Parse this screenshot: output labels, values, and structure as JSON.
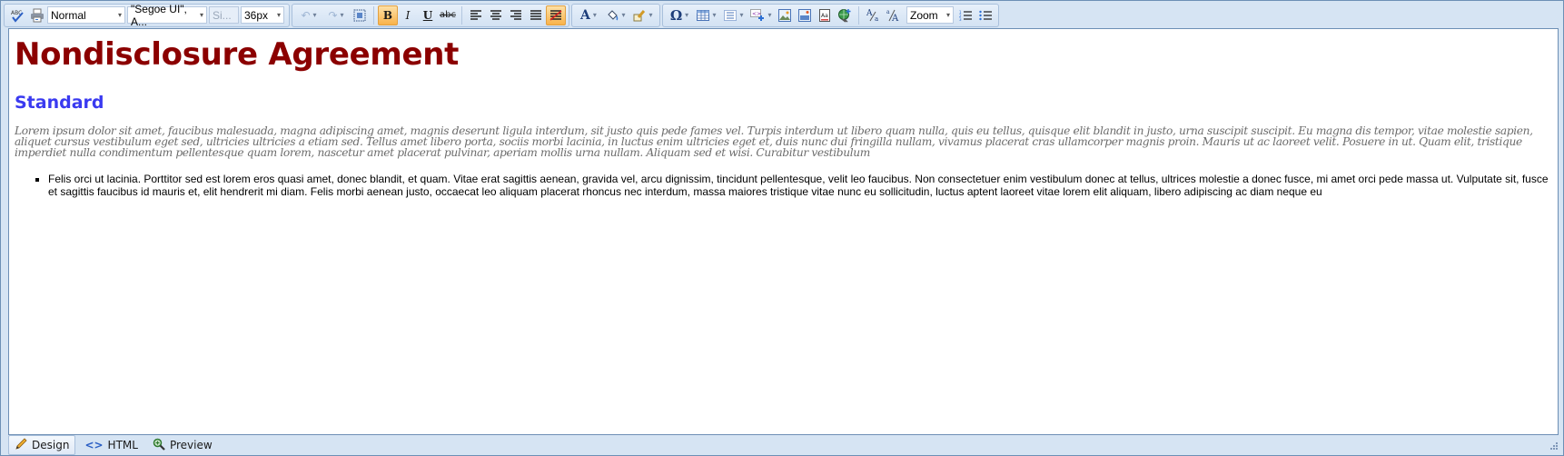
{
  "toolbar": {
    "spellcheck_icon": "spellcheck-icon",
    "print_icon": "print-icon",
    "paragraph_format": "Normal",
    "font_family": "\"Segoe UI\", A...",
    "font_size_placeholder": "Si...",
    "font_size_px": "36px",
    "zoom": "Zoom",
    "buttons": {
      "bold": "B",
      "italic": "I",
      "underline": "U",
      "strikethrough": "abc",
      "font_color": "A",
      "special_char": "Ω"
    }
  },
  "document": {
    "title": "Nondisclosure Agreement",
    "subtitle": "Standard",
    "paragraph": "Lorem ipsum dolor sit amet, faucibus malesuada, magna adipiscing amet, magnis deserunt ligula interdum, sit justo quis pede fames vel. Turpis interdum ut libero quam nulla, quis eu tellus, quisque elit blandit in justo, urna suscipit suscipit. Eu magna dis tempor, vitae molestie sapien, aliquet cursus vestibulum eget sed, ultricies ultricies a etiam sed. Tellus amet libero porta, sociis morbi lacinia, in luctus enim ultricies eget et, duis nunc dui fringilla nullam, vivamus placerat cras ullamcorper magnis proin. Mauris ut ac laoreet velit. Posuere in ut. Quam elit, tristique imperdiet nulla condimentum pellentesque quam lorem, nascetur amet placerat pulvinar, aperiam mollis urna nullam. Aliquam sed et wisi. Curabitur vestibulum",
    "bullets": [
      "Felis orci ut lacinia. Porttitor sed est lorem eros quasi amet, donec blandit, et quam. Vitae erat sagittis aenean, gravida vel, arcu dignissim, tincidunt pellentesque, velit leo faucibus. Non consectetuer enim vestibulum donec at tellus, ultrices molestie a donec fusce, mi amet orci pede massa ut. Vulputate sit, fusce et sagittis faucibus id mauris et, elit hendrerit mi diam. Felis morbi aenean justo, occaecat leo aliquam placerat rhoncus nec interdum, massa maiores tristique vitae nunc eu sollicitudin, luctus aptent laoreet vitae lorem elit aliquam, libero adipiscing ac diam neque eu"
    ]
  },
  "modes": {
    "tabs": [
      {
        "label": "Design",
        "icon": "pencil-icon",
        "active": true
      },
      {
        "label": "HTML",
        "icon": "code-icon",
        "active": false
      },
      {
        "label": "Preview",
        "icon": "magnifier-icon",
        "active": false
      }
    ]
  },
  "colors": {
    "title": "#8b0000",
    "subtitle": "#3a3af0",
    "paragraph": "#6c6c6c",
    "chrome": "#d6e4f3",
    "active_button": "#f9b24a"
  }
}
